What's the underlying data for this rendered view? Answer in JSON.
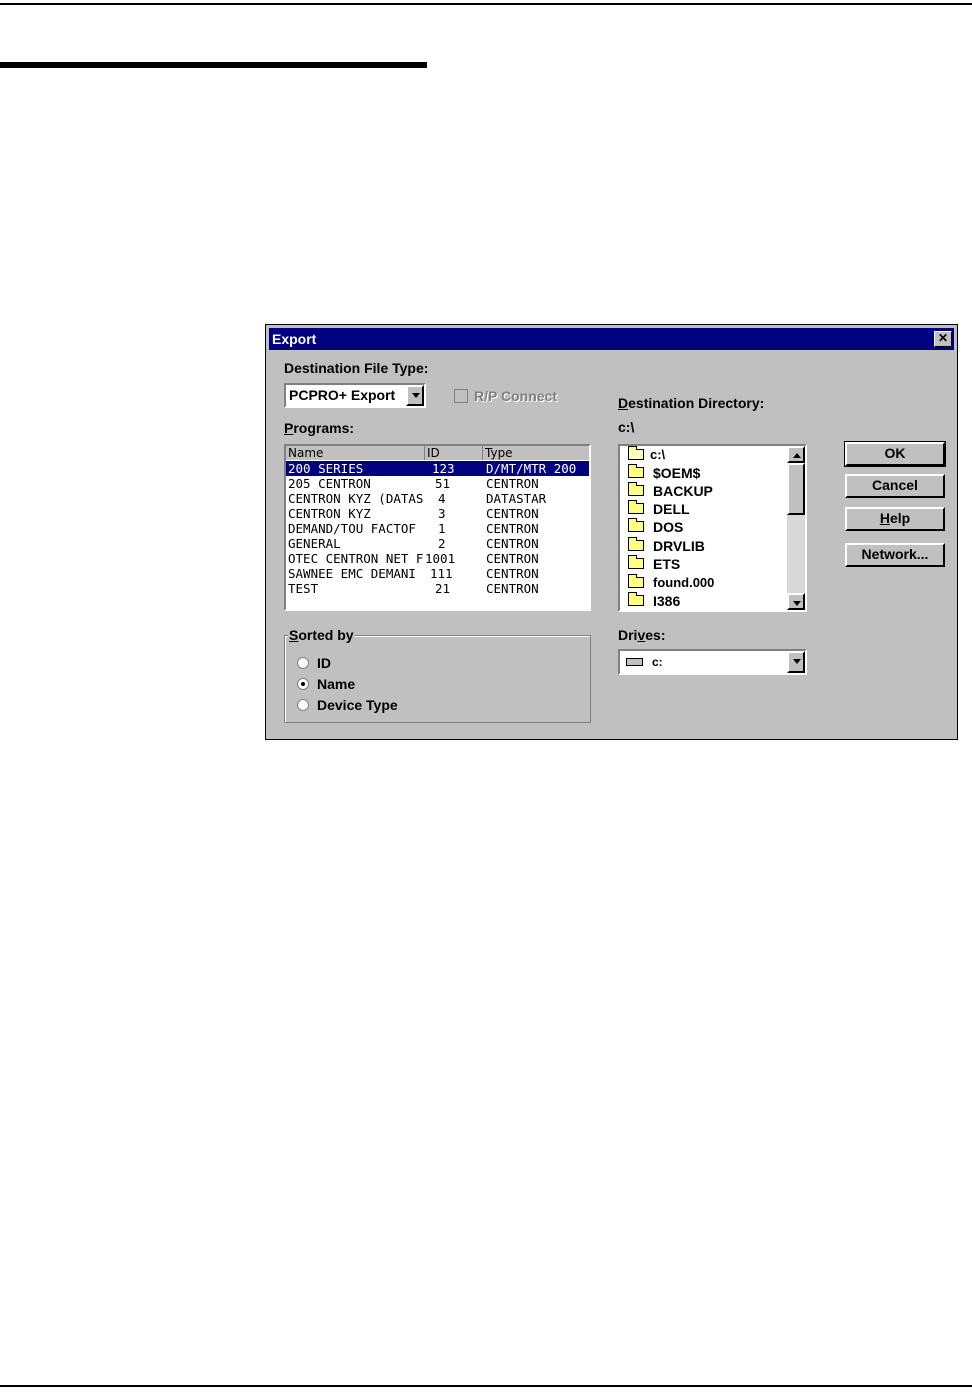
{
  "dialog": {
    "title": "Export",
    "close_glyph": "✕",
    "dest_file_type": {
      "label": "Destination File Type:",
      "value": "PCPRO+ Export"
    },
    "rp_connect": {
      "label": "R/P Connect",
      "checked": false,
      "enabled": false
    },
    "programs": {
      "label_u": "P",
      "label_rest": "rograms:",
      "columns": [
        "Name",
        "ID",
        "Type"
      ],
      "rows": [
        {
          "name": "200 SERIES",
          "id": "123",
          "type": "D/MT/MTR 200",
          "selected": true
        },
        {
          "name": "205 CENTRON",
          "id": "51",
          "type": "CENTRON"
        },
        {
          "name": "CENTRON KYZ (DATAS",
          "id": "4",
          "type": "DATASTAR"
        },
        {
          "name": "CENTRON KYZ",
          "id": "3",
          "type": "CENTRON"
        },
        {
          "name": "DEMAND/TOU FACTOF",
          "id": "1",
          "type": "CENTRON"
        },
        {
          "name": "GENERAL",
          "id": "2",
          "type": "CENTRON"
        },
        {
          "name": "OTEC CENTRON NET F",
          "id": "1001",
          "type": "CENTRON"
        },
        {
          "name": "SAWNEE EMC DEMANI",
          "id": "111",
          "type": "CENTRON"
        },
        {
          "name": "TEST",
          "id": "21",
          "type": "CENTRON"
        }
      ]
    },
    "destination_directory": {
      "label_u": "D",
      "label_rest": "estination Directory:",
      "path": "c:\\",
      "folders": [
        "c:\\",
        "$OEM$",
        "BACKUP",
        "DELL",
        "DOS",
        "DRVLIB",
        "ETS",
        "found.000",
        "I386"
      ]
    },
    "sorted_by": {
      "label_u": "S",
      "label_rest": "orted by",
      "options": [
        "ID",
        "Name",
        "Device Type"
      ],
      "selected": "Name"
    },
    "drives": {
      "label_pre": "Dri",
      "label_u": "v",
      "label_post": "es:",
      "value": "c:"
    },
    "buttons": {
      "ok": "OK",
      "cancel": "Cancel",
      "help_u": "H",
      "help_rest": "elp",
      "network": "Network..."
    }
  }
}
